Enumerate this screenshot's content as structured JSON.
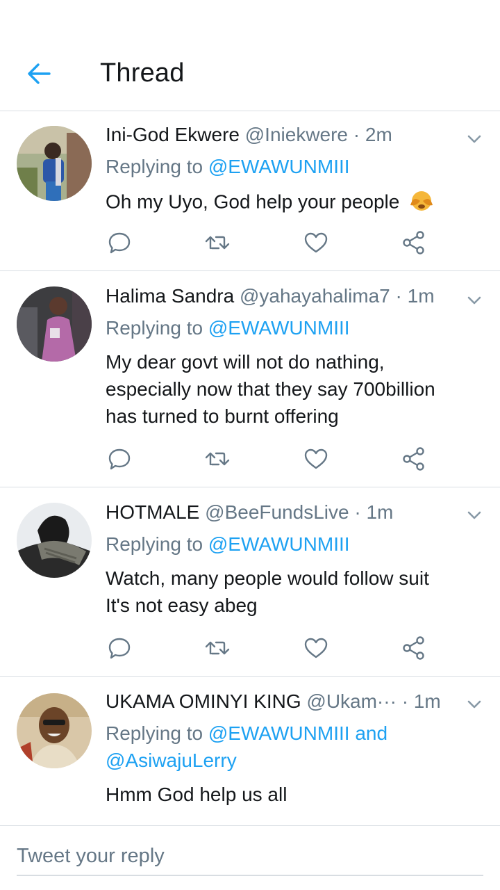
{
  "header": {
    "title": "Thread"
  },
  "tweets": [
    {
      "name": "Ini-God Ekwere",
      "handle": "@Iniekwere",
      "dot": "·",
      "time": "2m",
      "replying_prefix": "Replying to",
      "replying_to": "@EWAWUNMIII",
      "replying_and": "",
      "replying_to2": "",
      "text": "Oh my Uyo, God help your people",
      "emoji": "🙈"
    },
    {
      "name": "Halima Sandra",
      "handle": "@yahayahalima7",
      "dot": "·",
      "time": "1m",
      "replying_prefix": "Replying to",
      "replying_to": "@EWAWUNMIII",
      "text_lines": [
        "My dear govt will not do nathing,",
        "especially now that they say 700billion",
        "has turned to burnt offering"
      ]
    },
    {
      "name": "HOTMALE",
      "handle": "@BeeFundsLive",
      "dot": "·",
      "time": "1m",
      "replying_prefix": "Replying to",
      "replying_to": "@EWAWUNMIII",
      "text_lines": [
        "Watch, many people would follow suit",
        "It's not easy abeg"
      ]
    },
    {
      "name": "UKAMA OMINYI KING",
      "handle": "@Ukam···",
      "dot": "·",
      "time": "1m",
      "replying_prefix": "Replying to",
      "replying_to": "@EWAWUNMIII",
      "replying_and": "and",
      "replying_to2": "@AsiwajuLerry",
      "text": "Hmm God help us all"
    }
  ],
  "composer": {
    "placeholder": "Tweet your reply"
  },
  "colors": {
    "accent": "#1da1f2",
    "muted": "#657786",
    "text": "#14171a",
    "divider": "#d8dde2"
  },
  "icons": [
    "back-arrow-icon",
    "chevron-down-icon",
    "reply-icon",
    "retweet-icon",
    "like-icon",
    "share-icon"
  ]
}
